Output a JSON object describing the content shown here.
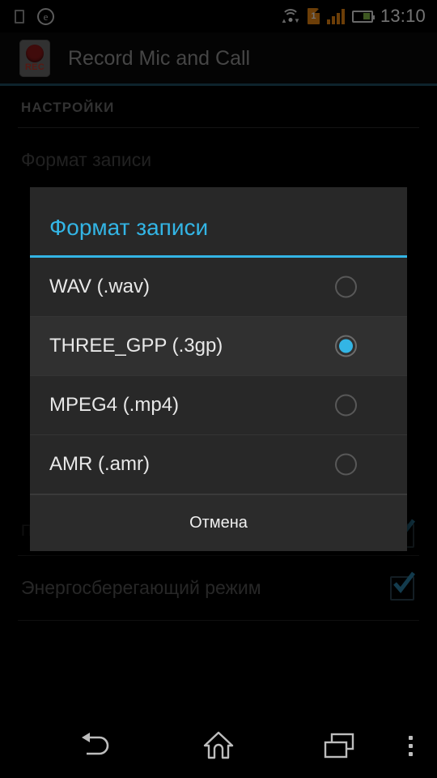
{
  "status_bar": {
    "left_icons": [
      {
        "name": "sim-card-icon",
        "label": ""
      },
      {
        "name": "opera-e-icon",
        "label": "e"
      }
    ],
    "right_icons": [
      {
        "name": "wifi-icon",
        "label": ""
      },
      {
        "name": "sim1-icon",
        "label": "1"
      },
      {
        "name": "signal-bars-icon",
        "label": ""
      },
      {
        "name": "battery-icon",
        "label": ""
      }
    ],
    "time": "13:10"
  },
  "action_bar": {
    "app_icon": "record-app-icon",
    "icon_text": "REC",
    "title": "Record Mic and Call",
    "accent_color": "#1d4f63"
  },
  "settings": {
    "section_header": "НАСТРОЙКИ",
    "items": [
      {
        "title": "Формат записи",
        "summary": "",
        "has_checkbox": false,
        "checked": false
      },
      {
        "title": "",
        "summary": "Показать или скрыть всплывающие сообщения",
        "has_checkbox": true,
        "checked": true
      },
      {
        "title": "Энергосберегающий режим",
        "summary": "",
        "has_checkbox": true,
        "checked": true
      }
    ]
  },
  "dialog": {
    "title": "Формат записи",
    "title_color": "#33b5e5",
    "selected_value": "THREE_GPP (.3gp)",
    "options": [
      {
        "label": "WAV (.wav)",
        "selected": false
      },
      {
        "label": "THREE_GPP (.3gp)",
        "selected": true
      },
      {
        "label": "MPEG4 (.mp4)",
        "selected": false
      },
      {
        "label": "AMR (.amr)",
        "selected": false
      }
    ],
    "cancel_label": "Отмена"
  },
  "nav_bar": {
    "buttons": [
      {
        "name": "back-button",
        "icon": "back-arrow-icon"
      },
      {
        "name": "home-button",
        "icon": "home-icon"
      },
      {
        "name": "recents-button",
        "icon": "recents-icon"
      },
      {
        "name": "overflow-menu-button",
        "icon": "three-dots-icon"
      }
    ]
  }
}
